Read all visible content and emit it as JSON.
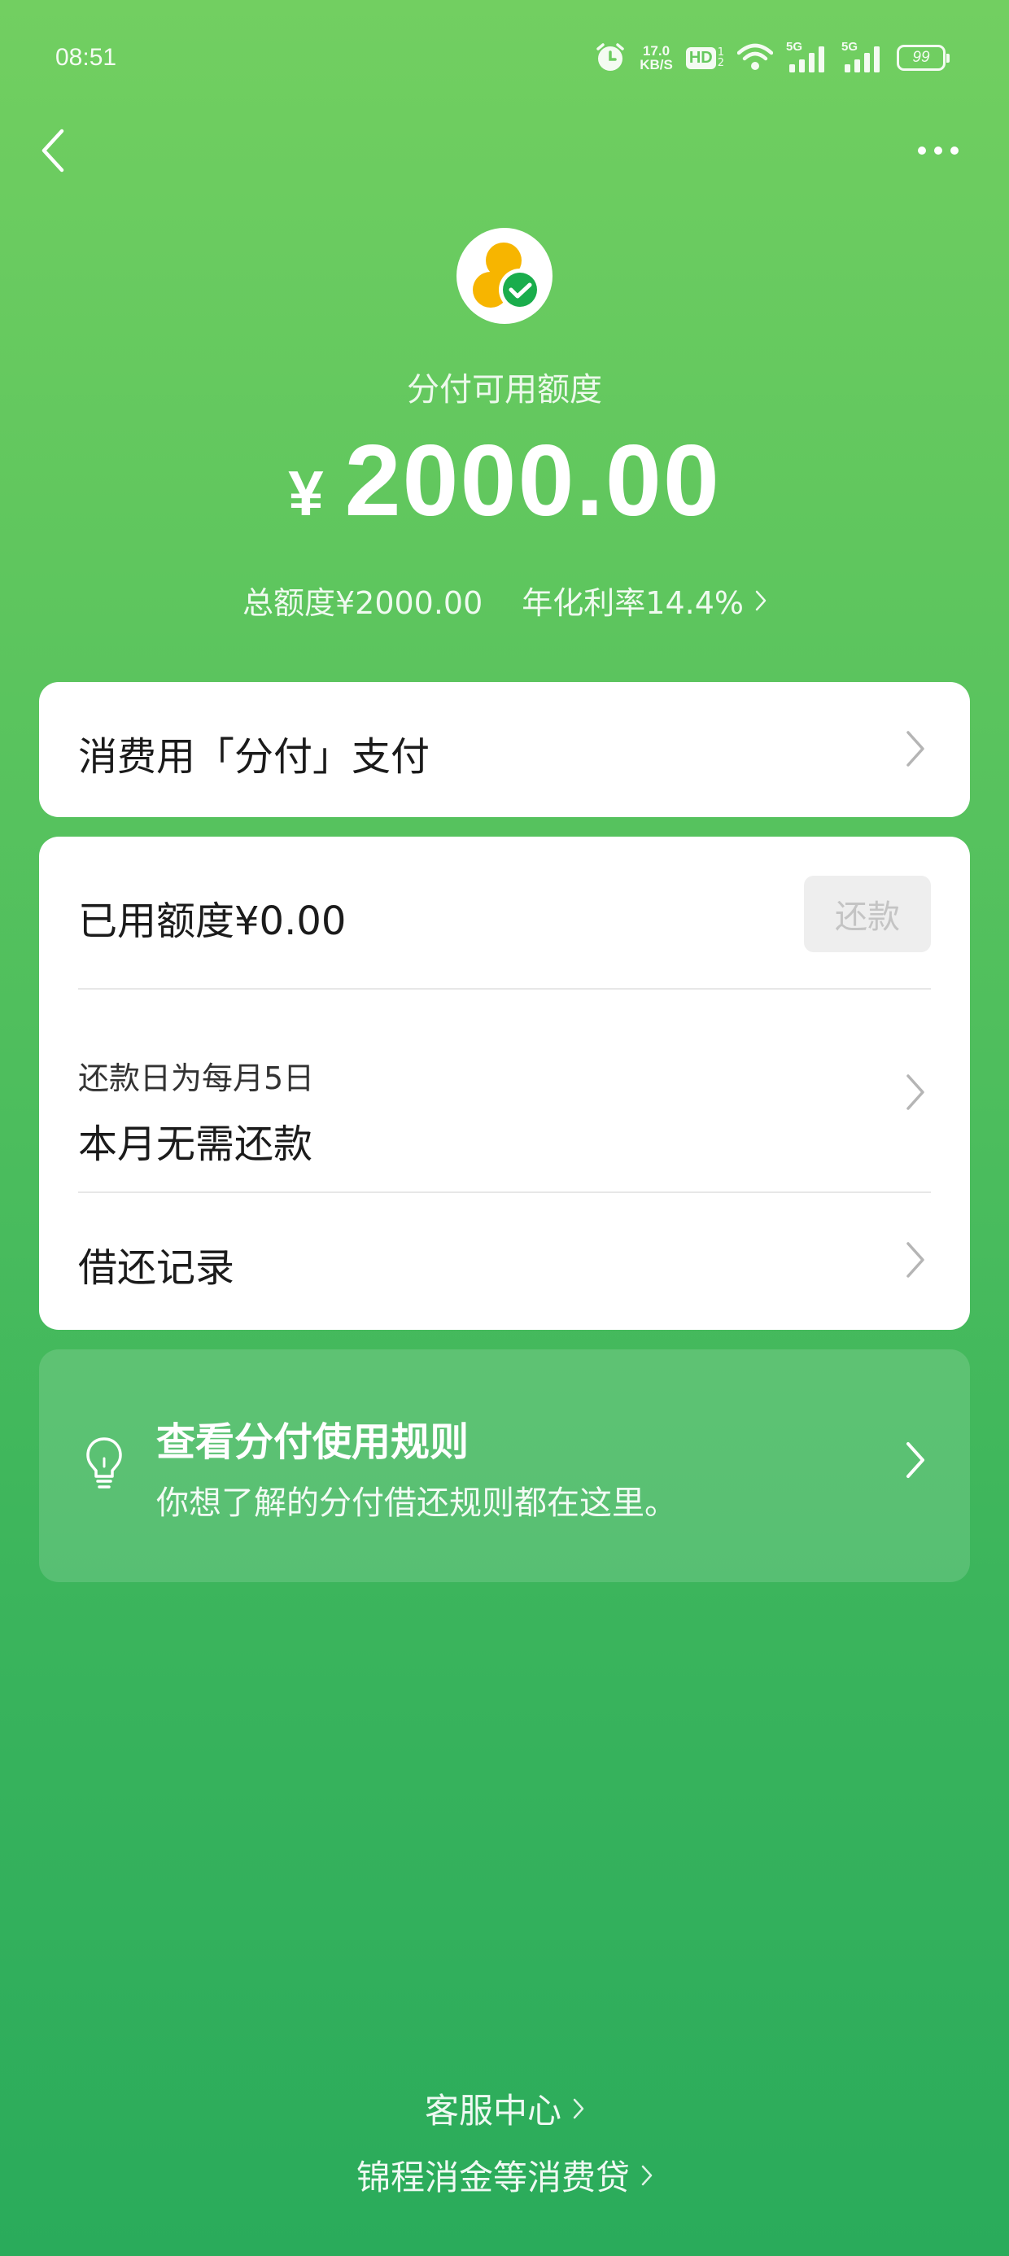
{
  "status_bar": {
    "time": "08:51",
    "net_speed_value": "17.0",
    "net_speed_unit": "KB/S",
    "hd_label": "HD",
    "hd_sub_top": "1",
    "hd_sub_bottom": "2",
    "signal1_label": "5G",
    "signal2_label": "5G",
    "battery_level": "99"
  },
  "nav": {
    "back_icon": "chevron-left-icon",
    "more_icon": "more-dots-icon"
  },
  "hero": {
    "label": "分付可用额度",
    "currency": "¥",
    "amount": "2000.00",
    "total_limit": "总额度¥2000.00",
    "annual_rate": "年化利率14.4%"
  },
  "pay_card": {
    "title": "消费用「分付」支付"
  },
  "credit_card": {
    "used_amount": "已用额度¥0.00",
    "repay_button": "还款",
    "repay_day": "还款日为每月5日",
    "repay_status": "本月无需还款",
    "records": "借还记录"
  },
  "rules_card": {
    "title": "查看分付使用规则",
    "description": "你想了解的分付借还规则都在这里。"
  },
  "footer": {
    "customer_service": "客服中心",
    "loan_link": "锦程消金等消费贷"
  },
  "colors": {
    "gradient_top": "#72cf61",
    "gradient_bottom": "#2aab5b",
    "logo_yellow": "#f7b500",
    "logo_green": "#1aad4c",
    "card_bg": "#ffffff",
    "disabled_button_bg": "#eeeeee"
  }
}
